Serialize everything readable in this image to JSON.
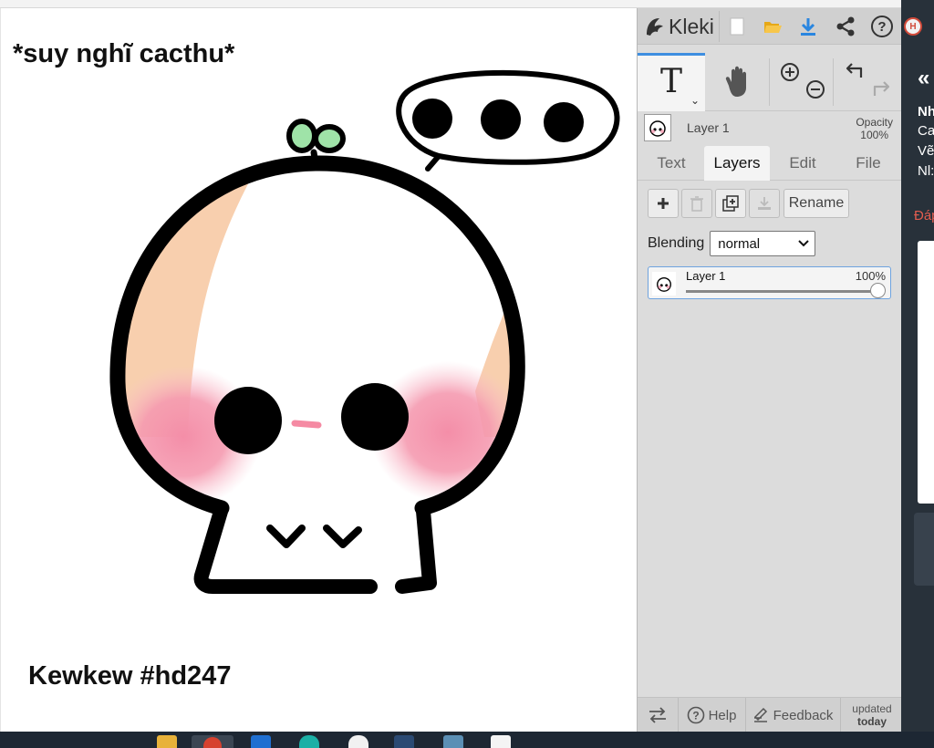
{
  "app": {
    "name": "Kleki"
  },
  "canvas": {
    "top_text": "*suy nghĩ cacthu*",
    "bottom_text": "Kewkew #hd247"
  },
  "toolbar": {
    "new_icon": "new-image-icon",
    "open_icon": "folder-icon",
    "save_icon": "download-icon",
    "share_icon": "share-icon",
    "help_icon": "help-icon"
  },
  "tools": {
    "text_tool_glyph": "T",
    "hand_icon": "hand-icon",
    "zoom_in_icon": "zoom-in-icon",
    "zoom_out_icon": "zoom-out-icon",
    "undo_icon": "undo-icon",
    "redo_icon": "redo-icon"
  },
  "layer_preview": {
    "name": "Layer 1",
    "opacity_label": "Opacity",
    "opacity_value": "100%"
  },
  "tabs": [
    {
      "label": "Text",
      "active": false
    },
    {
      "label": "Layers",
      "active": true
    },
    {
      "label": "Edit",
      "active": false
    },
    {
      "label": "File",
      "active": false
    }
  ],
  "layer_buttons": {
    "add_icon": "plus-icon",
    "delete_icon": "trash-icon",
    "duplicate_icon": "duplicate-icon",
    "merge_icon": "merge-down-icon",
    "rename_label": "Rename"
  },
  "blending": {
    "label": "Blending",
    "value": "normal"
  },
  "layers": [
    {
      "name": "Layer 1",
      "opacity": "100%",
      "opacity_fraction": 1.0
    }
  ],
  "footer": {
    "swap_icon": "swap-icon",
    "help_label": "Help",
    "feedback_label": "Feedback",
    "updated_line1": "updated",
    "updated_line2": "today"
  },
  "side_page": {
    "chevron": "«",
    "lines": [
      "Nh",
      "Ca",
      "Vẽ",
      "Nl:"
    ],
    "red_text": "Đáp"
  },
  "colors": {
    "panel_bg": "#dcdcdc",
    "active_tab_bg": "#f4f4f4",
    "accent_blue": "#3e8ee0",
    "dark_strip": "#28313a",
    "blush_pink": "#f48ea8",
    "peach": "#f8cfae",
    "sprout_green": "#9fe3a8"
  }
}
